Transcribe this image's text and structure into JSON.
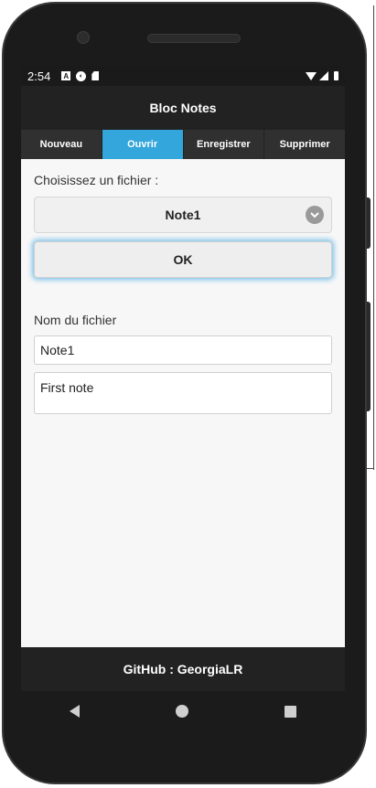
{
  "status_bar": {
    "time": "2:54",
    "icons": [
      "a-notification-icon",
      "circle-notification-icon",
      "sd-card-icon",
      "wifi-icon",
      "signal-icon",
      "battery-icon"
    ]
  },
  "app_bar": {
    "title": "Bloc Notes"
  },
  "tabs": [
    {
      "label": "Nouveau",
      "active": false
    },
    {
      "label": "Ouvrir",
      "active": true
    },
    {
      "label": "Enregistrer",
      "active": false
    },
    {
      "label": "Supprimer",
      "active": false
    }
  ],
  "open_form": {
    "choose_label": "Choisissez un fichier :",
    "selected_file": "Note1",
    "ok_label": "OK"
  },
  "edit_form": {
    "filename_label": "Nom du fichier",
    "filename_value": "Note1",
    "content_value": "First note"
  },
  "footer": {
    "text": "GitHub : GeorgiaLR"
  },
  "colors": {
    "accent": "#33a6dc",
    "bar": "#222222",
    "background": "#f7f7f7"
  }
}
